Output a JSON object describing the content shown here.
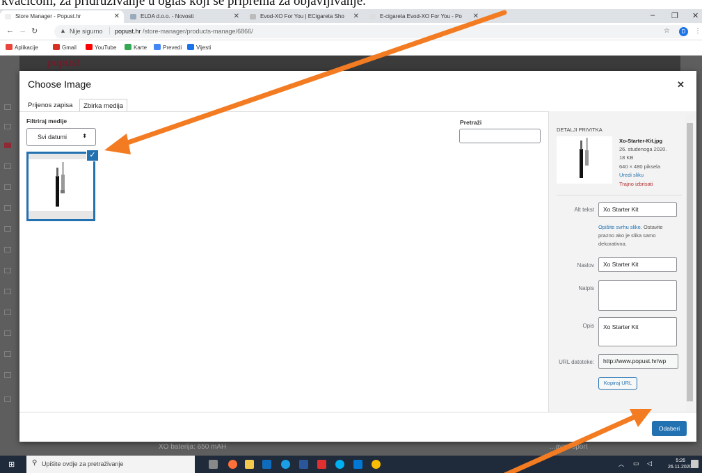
{
  "caption": {
    "text": "kvaciсom, za pridruživanje u oglas koji se priprema za objavljivanje."
  },
  "browser": {
    "tabs": [
      {
        "label": "Store Manager - Popust.hr"
      },
      {
        "label": "ELDA d.o.o. - Novosti"
      },
      {
        "label": "Evod-XO For You | ECigareta Sho"
      },
      {
        "label": "E-cigareta Evod-XO For You - Po"
      }
    ],
    "new_tab": "+",
    "url_warning": "Nije sigurno",
    "url_host": "popust.hr",
    "url_path": "/store-manager/products-manage/6866/",
    "profile_initial": "D",
    "bookmarks": [
      {
        "label": "Aplikacije",
        "color": "#e8453c"
      },
      {
        "label": "Gmail",
        "color": "#d93025"
      },
      {
        "label": "YouTube",
        "color": "#ff0000"
      },
      {
        "label": "Karte",
        "color": "#34a853"
      },
      {
        "label": "Prevedi",
        "color": "#4285f4"
      },
      {
        "label": "Vijesti",
        "color": "#1a73e8"
      }
    ]
  },
  "site": {
    "logo": "popust",
    "below_text": "XO baterija: 650 mAH",
    "below_right": "...ava i sport"
  },
  "modal": {
    "title": "Choose Image",
    "tabs": [
      "Prijenos zapisa",
      "Zbirka medija"
    ],
    "filter_label": "Filtriraj medije",
    "date_select": "Svi datumi",
    "search_label": "Pretraži",
    "search_value": "",
    "details": {
      "heading": "DETALJI PRIVITKA",
      "filename": "Xo-Starter-Kit.jpg",
      "date": "26. studenoga 2020.",
      "size": "18 KB",
      "dimensions": "640 × 480 piksela",
      "edit_link": "Uredi sliku",
      "delete_link": "Trajno izbrisati",
      "alt_label": "Alt tekst",
      "alt_value": "Xo Starter Kit",
      "alt_help_link": "Opišite svrhu slike",
      "alt_help_rest": ". Ostavite prazno ako je slika samo dekorativna.",
      "title_label": "Naslov",
      "title_value": "Xo Starter Kit",
      "caption_label": "Natpis",
      "caption_value": "",
      "desc_label": "Opis",
      "desc_value": "Xo Starter Kit",
      "url_label": "URL datoteke:",
      "url_value": "http://www.popust.hr/wp",
      "copy_url": "Kopiraj URL"
    },
    "select_button": "Odaberi"
  },
  "taskbar": {
    "search_placeholder": "Upišite ovdje za pretraživanje",
    "time": "5:26",
    "date": "26.11.2020."
  },
  "colors": {
    "accent": "#2271b1",
    "arrow": "#f37b21",
    "danger": "#b32d2e"
  }
}
